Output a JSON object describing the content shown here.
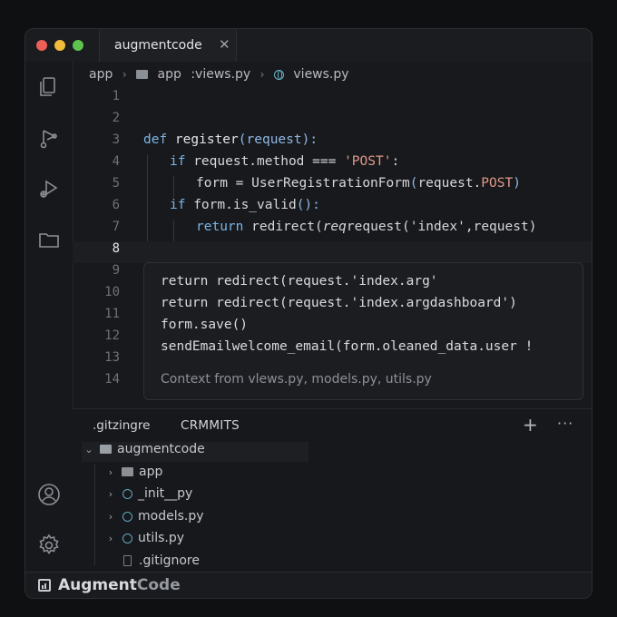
{
  "window": {
    "tab_title": "augmentcode",
    "tab_close": "✕"
  },
  "breadcrumb": {
    "part1": "app",
    "part2": "app",
    "part3": ":views.py",
    "part4": "views.py"
  },
  "editor": {
    "line_numbers": [
      "1",
      "2",
      "3",
      "4",
      "5",
      "6",
      "7",
      "8",
      "9",
      "10",
      "11",
      "12",
      "13",
      "14"
    ],
    "active_line": "8",
    "lines": {
      "l2": {
        "kw": "def",
        "name": " register",
        "open": "(",
        "param": "request",
        "close": "):"
      },
      "l3": {
        "kw": "if",
        "rest": " request.method === ",
        "str": "'POST'",
        "end": ":"
      },
      "l4": {
        "a": "form = UserRegistrationForm",
        "b": "(",
        "c": "request.",
        "d": "POST",
        "e": ")"
      },
      "l5": {
        "kw": "if",
        "rest": " form.is_valid",
        "paren": "():"
      },
      "l6": {
        "kw": "return",
        "rest": " redirect(",
        "it": "req",
        "rest2": "request(",
        "str": "'index",
        "rest3": "',request)"
      }
    }
  },
  "suggestion": {
    "lines": [
      "return redirect(request.'index.arg'",
      "return redirect(request.'index.argdashboard')",
      "form.save()",
      "sendEmailwelcome_email(form.oleaned_data.user !"
    ],
    "context": "Context from vlews.py, models.py, utils.py"
  },
  "panel": {
    "tab1": ".gitzingre",
    "tab2": "CRMMITS",
    "add": "+",
    "more": "···",
    "tree": {
      "root": "augmentcode",
      "items": [
        "app",
        "_init__py",
        "models.py",
        "utils.py",
        ".gitignore"
      ]
    }
  },
  "status": {
    "brand_a": "Augment",
    "brand_b": "Code"
  },
  "colors": {
    "keyword": "#7ab4e8",
    "string": "#e09a8a",
    "background": "#18191c",
    "red": "#ec5f57",
    "yellow": "#f0bd3a",
    "green": "#5fc24f"
  }
}
